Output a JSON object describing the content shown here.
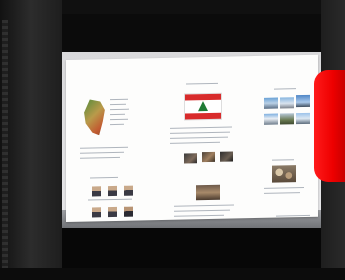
{
  "scene": {
    "subject": "Lebanon",
    "flag_colors": {
      "band": "#d82b2b",
      "field": "#ffffff",
      "cedar": "#1f7a34"
    },
    "accent_object_color": "#ee0000"
  },
  "poster": {
    "sections": [
      "",
      "",
      "",
      "",
      "",
      "",
      ""
    ]
  }
}
